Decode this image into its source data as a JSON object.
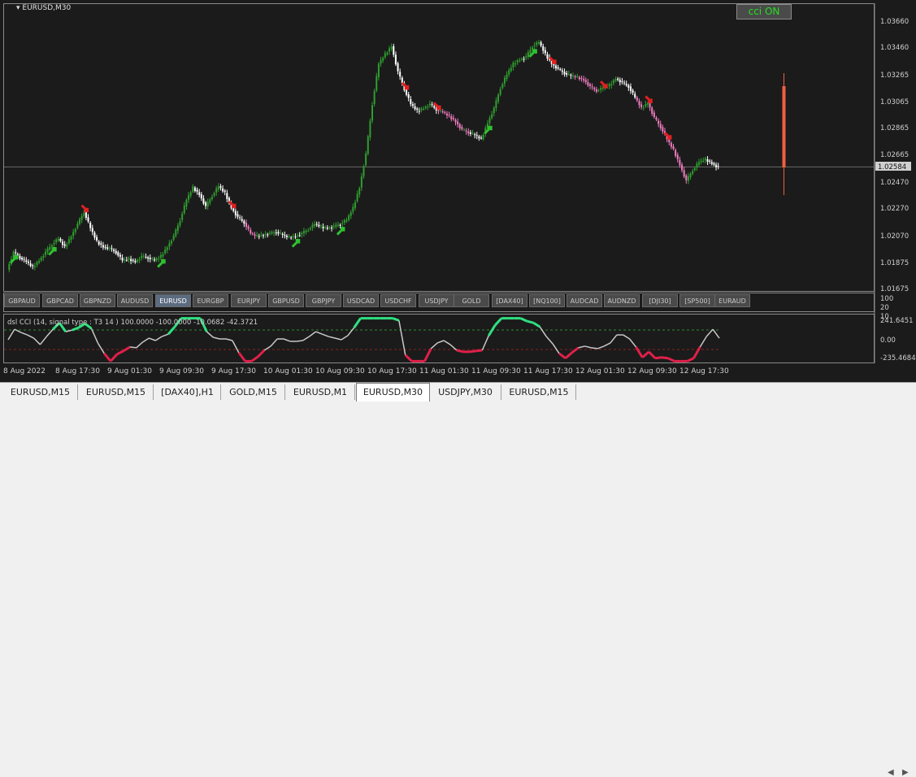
{
  "chart": {
    "title": "EURUSD,M30",
    "current_price": "1.02584",
    "price_ticks": [
      "1.03660",
      "1.03460",
      "1.03265",
      "1.03065",
      "1.02865",
      "1.02665",
      "1.02470",
      "1.02270",
      "1.02070",
      "1.01875",
      "1.01675"
    ],
    "price_range": [
      1.01675,
      1.0366
    ],
    "cci_button": "cci ON",
    "colors": {
      "background": "#1b1b1b",
      "bull_candle": "#2f9e2f",
      "bear_candle": "#ffffff",
      "pink_candle": "#f07cc0",
      "up_arrow": "#2fc02f",
      "down_arrow": "#e02020",
      "cci_up": "#30e080",
      "cci_down": "#e0204a",
      "cci_neutral": "#c8c8c8",
      "marker_bar": "#f06040"
    }
  },
  "symbols": [
    "GBPAUD",
    "GBPCAD",
    "GBPNZD",
    "AUDUSD",
    "EURUSD",
    "EURGBP",
    "EURJPY",
    "GBPUSD",
    "GBPJPY",
    "USDCAD",
    "USDCHF",
    "USDJPY",
    "GOLD",
    "[DAX40]",
    "[NQ100]",
    "AUDCAD",
    "AUDNZD",
    "[DJI30]",
    "[SP500]",
    "EURAUD"
  ],
  "active_symbol": "EURUSD",
  "symbol_scale": [
    "100",
    "20",
    "10"
  ],
  "indicator": {
    "title": "dsl CCI  (14, signal type : T3  14 ) 100.0000 -100.0000 -10.0682 -42.3721",
    "ticks": [
      "241.6451",
      "0.00",
      "-235.4684"
    ]
  },
  "time_labels": [
    "8 Aug 2022",
    "8 Aug 17:30",
    "9 Aug 01:30",
    "9 Aug 09:30",
    "9 Aug 17:30",
    "10 Aug 01:30",
    "10 Aug 09:30",
    "10 Aug 17:30",
    "11 Aug 01:30",
    "11 Aug 09:30",
    "11 Aug 17:30",
    "12 Aug 01:30",
    "12 Aug 09:30",
    "12 Aug 17:30"
  ],
  "tabs": [
    "EURUSD,M15",
    "EURUSD,M15",
    "[DAX40],H1",
    "GOLD,M15",
    "EURUSD,M1",
    "EURUSD,M30",
    "USDJPY,M30",
    "EURUSD,M15"
  ],
  "active_tab_index": 5,
  "chart_data": {
    "type": "line",
    "series": [
      {
        "values": [
          1.0182,
          1.0195,
          1.0191,
          1.0188,
          1.0184,
          1.0189,
          1.0195,
          1.0201,
          1.0205,
          1.0199,
          1.0207,
          1.0216,
          1.0225,
          1.0213,
          1.0203,
          1.0199,
          1.0198,
          1.0195,
          1.0189,
          1.019,
          1.0188,
          1.0192,
          1.0191,
          1.0189,
          1.0192,
          1.0199,
          1.0207,
          1.0219,
          1.0234,
          1.0243,
          1.0238,
          1.0229,
          1.0237,
          1.0244,
          1.0239,
          1.0228,
          1.0221,
          1.0217,
          1.0209,
          1.0207,
          1.0208,
          1.0209,
          1.021,
          1.0208,
          1.0206,
          1.0207,
          1.0209,
          1.0212,
          1.0216,
          1.0214,
          1.0213,
          1.0214,
          1.0216,
          1.0219,
          1.0228,
          1.0243,
          1.0268,
          1.0305,
          1.0335,
          1.0342,
          1.0348,
          1.0329,
          1.0316,
          1.0305,
          1.03,
          1.0302,
          1.0305,
          1.0301,
          1.0299,
          1.0296,
          1.0292,
          1.0286,
          1.0284,
          1.0282,
          1.0279,
          1.0291,
          1.0302,
          1.0317,
          1.0327,
          1.0335,
          1.0338,
          1.034,
          1.0348,
          1.0351,
          1.0342,
          1.0335,
          1.0331,
          1.0328,
          1.0326,
          1.0325,
          1.0323,
          1.0318,
          1.0315,
          1.0317,
          1.0319,
          1.0324,
          1.0321,
          1.0318,
          1.031,
          1.0302,
          1.0306,
          1.0295,
          1.0288,
          1.0279,
          1.0271,
          1.026,
          1.0248,
          1.0256,
          1.0262,
          1.0264,
          1.0261,
          1.0258
        ]
      }
    ]
  }
}
